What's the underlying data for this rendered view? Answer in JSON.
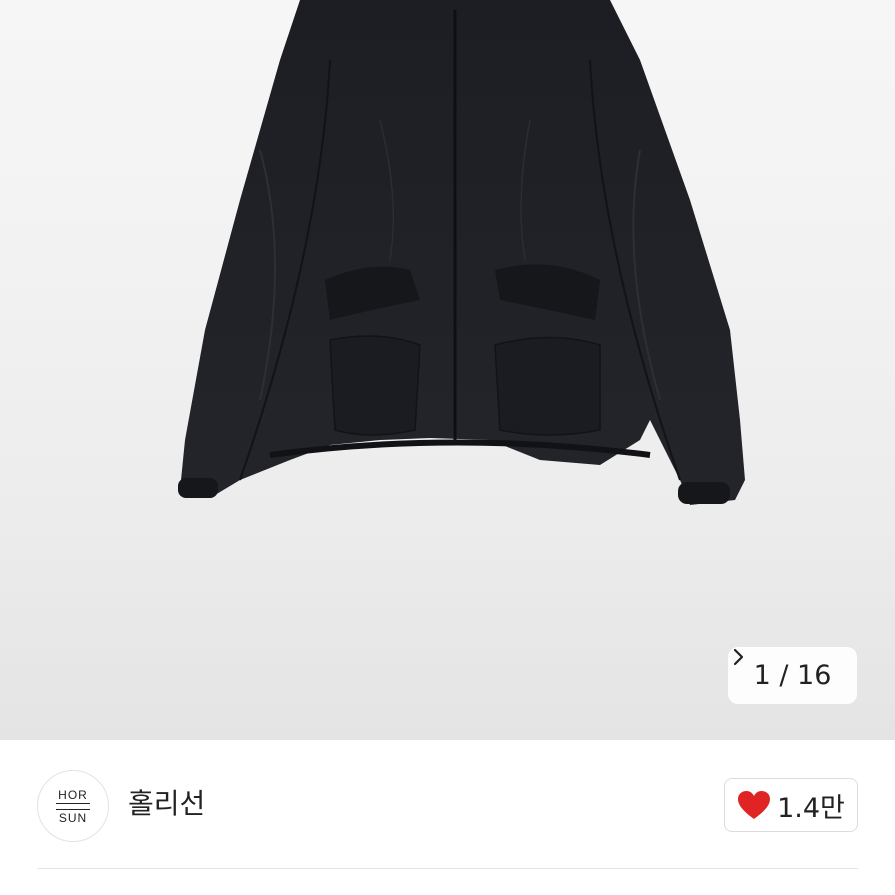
{
  "gallery": {
    "image_alt_icon": "product-photo",
    "current_index": "1",
    "separator": " / ",
    "total": "16",
    "counter_text": "1 / 16",
    "next_icon": "chevron-right-icon"
  },
  "shop": {
    "logo_top": "HOR",
    "logo_bottom": "SUN",
    "name": "홀리선"
  },
  "like": {
    "icon": "heart-icon",
    "count": "1.4만",
    "heart_color": "#e02424"
  }
}
